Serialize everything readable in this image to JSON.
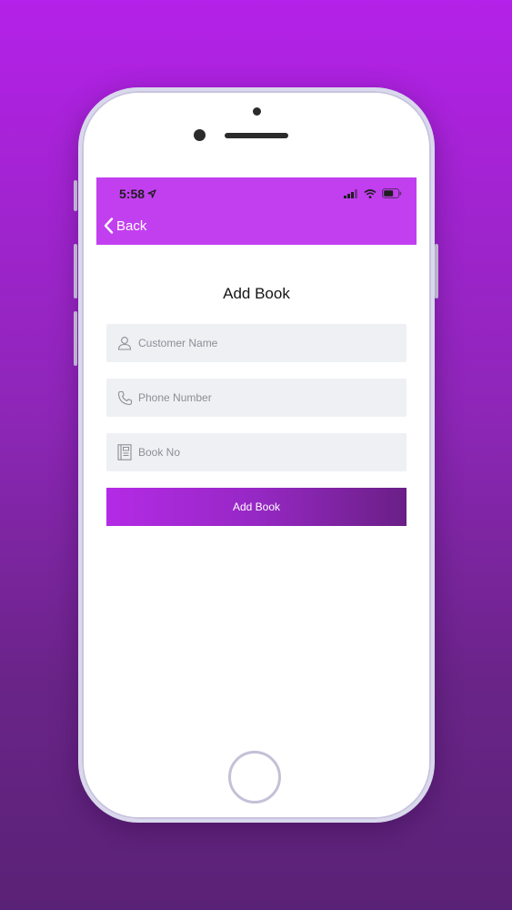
{
  "status_bar": {
    "time": "5:58",
    "icons": [
      "location-arrow-icon",
      "cellular-signal-icon",
      "wifi-icon",
      "battery-icon"
    ]
  },
  "nav": {
    "back_label": "Back"
  },
  "page": {
    "title": "Add Book"
  },
  "form": {
    "customer_name": {
      "placeholder": "Customer Name",
      "value": "",
      "icon": "user-icon"
    },
    "phone_number": {
      "placeholder": "Phone Number",
      "value": "",
      "icon": "phone-icon"
    },
    "book_no": {
      "placeholder": "Book No",
      "value": "",
      "icon": "book-icon"
    },
    "submit_label": "Add Book"
  },
  "colors": {
    "background_top": "#b421e8",
    "background_bottom": "#5a2276",
    "nav_bar": "#c23ff0",
    "button_start": "#b42ae6",
    "button_end": "#6a1f86",
    "field_bg": "#eef0f4"
  }
}
